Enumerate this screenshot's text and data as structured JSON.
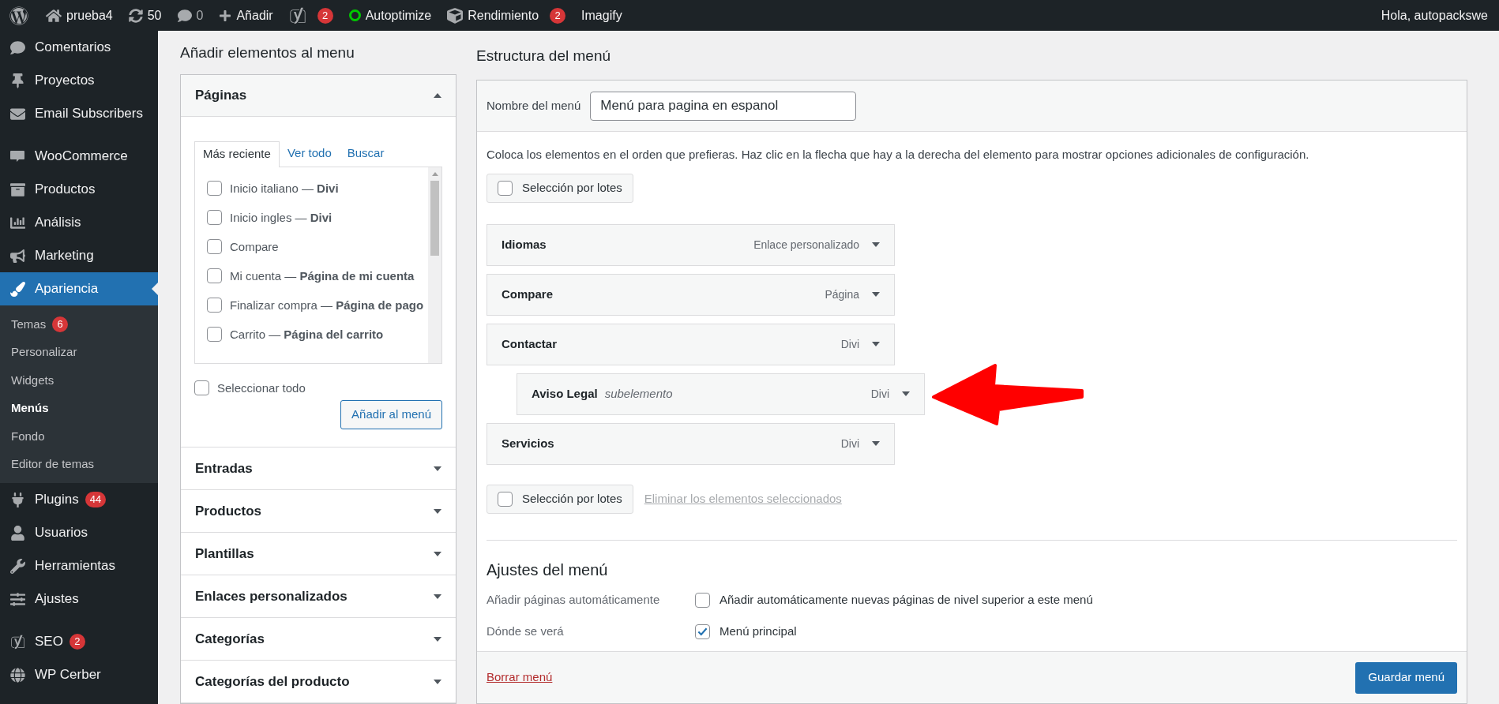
{
  "admin_bar": {
    "site": "prueba4",
    "updates": "50",
    "comments": "0",
    "new": "Añadir",
    "yoast_badge": "2",
    "autoptimize": "Autoptimize",
    "performance": "Rendimiento",
    "performance_badge": "2",
    "imagify": "Imagify",
    "greeting": "Hola, autopackswe"
  },
  "sidebar": {
    "items": [
      {
        "label": "Comentarios",
        "selected": false
      },
      {
        "label": "Proyectos",
        "selected": false
      },
      {
        "label": "Email Subscribers",
        "selected": false
      },
      {
        "label": "WooCommerce",
        "selected": false
      },
      {
        "label": "Productos",
        "selected": false
      },
      {
        "label": "Análisis",
        "selected": false
      },
      {
        "label": "Marketing",
        "selected": false
      },
      {
        "label": "Apariencia",
        "selected": true,
        "children": [
          {
            "label": "Temas",
            "badge": "6",
            "selected": false
          },
          {
            "label": "Personalizar",
            "selected": false
          },
          {
            "label": "Widgets",
            "selected": false
          },
          {
            "label": "Menús",
            "selected": true
          },
          {
            "label": "Fondo",
            "selected": false
          },
          {
            "label": "Editor de temas",
            "selected": false
          }
        ]
      },
      {
        "label": "Plugins",
        "badge": "44",
        "selected": false
      },
      {
        "label": "Usuarios",
        "selected": false
      },
      {
        "label": "Herramientas",
        "selected": false
      },
      {
        "label": "Ajustes",
        "selected": false
      },
      {
        "label": "SEO",
        "badge": "2",
        "selected": false
      },
      {
        "label": "WP Cerber",
        "selected": false
      }
    ]
  },
  "add_items": {
    "title": "Añadir elementos al menu",
    "sections": [
      {
        "title": "Páginas",
        "expanded": true,
        "tabs": [
          {
            "label": "Más reciente",
            "selected": true
          },
          {
            "label": "Ver todo",
            "selected": false
          },
          {
            "label": "Buscar",
            "selected": false
          }
        ],
        "pages": [
          {
            "label": "Inicio italiano — **Divi**",
            "checked": false
          },
          {
            "label": "Inicio ingles — **Divi**",
            "checked": false
          },
          {
            "label": "Compare",
            "checked": false
          },
          {
            "label": "Mi cuenta — **Página de mi cuenta**",
            "checked": false
          },
          {
            "label": "Finalizar compra — **Página de pago**",
            "checked": false
          },
          {
            "label": "Carrito — **Página del carrito**",
            "checked": false
          }
        ],
        "select_all": {
          "label": "Seleccionar todo",
          "checked": false
        },
        "button": "Añadir al menú"
      },
      {
        "title": "Entradas",
        "expanded": false
      },
      {
        "title": "Productos",
        "expanded": false
      },
      {
        "title": "Plantillas",
        "expanded": false
      },
      {
        "title": "Enlaces personalizados",
        "expanded": false
      },
      {
        "title": "Categorías",
        "expanded": false
      },
      {
        "title": "Categorías del producto",
        "expanded": false
      }
    ]
  },
  "structure": {
    "title": "Estructura del menú",
    "name_label": "Nombre del menú",
    "name_value": "Menú para pagina en espanol",
    "instructions": "Coloca los elementos en el orden que prefieras. Haz clic en la flecha que hay a la derecha del elemento para mostrar opciones adicionales de configuración.",
    "bulk_top": {
      "label": "Selección por lotes",
      "checked": false
    },
    "items": [
      {
        "title": "Idiomas",
        "type": "Enlace personalizado"
      },
      {
        "title": "Compare",
        "type": "Página"
      },
      {
        "title": "Contactar",
        "type": "Divi",
        "children": [
          {
            "title": "Aviso Legal",
            "note": "subelemento",
            "type": "Divi"
          }
        ]
      },
      {
        "title": "Servicios",
        "type": "Divi"
      }
    ],
    "bulk_bottom": {
      "label": "Selección por lotes",
      "checked": false
    },
    "remove_selected": "Eliminar los elementos seleccionados",
    "settings": {
      "title": "Ajustes del menú",
      "rows": [
        {
          "label": "Añadir páginas automáticamente",
          "option": "Añadir automáticamente nuevas páginas de nivel superior a este menú",
          "checked": false
        },
        {
          "label": "Dónde se verá",
          "option": "Menú principal",
          "checked": true
        }
      ]
    },
    "delete": "Borrar menú",
    "save": "Guardar menú"
  }
}
